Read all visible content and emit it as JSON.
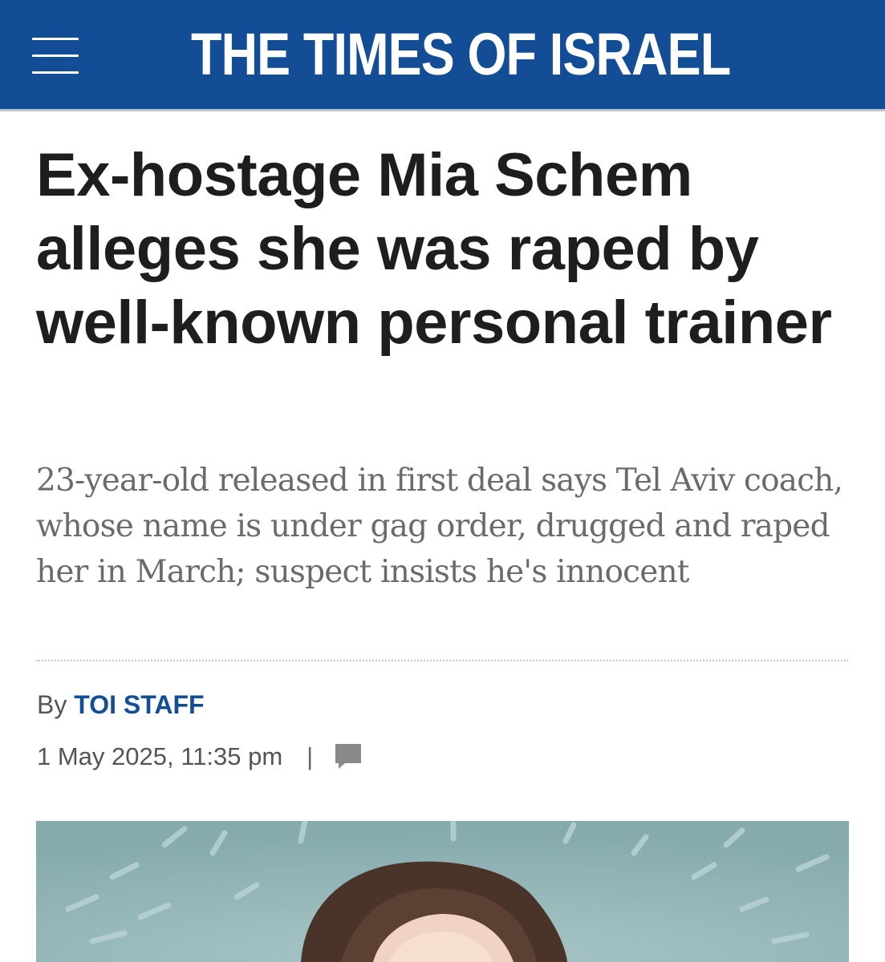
{
  "header": {
    "menu_icon": "hamburger-menu-icon",
    "site_name": "THE TIMES OF ISRAEL",
    "brand_color": "#124d96"
  },
  "article": {
    "headline": "Ex-hostage Mia Schem alleges she was raped by well-known personal trainer",
    "subheadline": "23-year-old released in first deal says Tel Aviv coach, whose name is under gag order, drugged and raped her in March; suspect insists he's innocent",
    "byline": {
      "prefix": "By",
      "author": "TOI STAFF"
    },
    "meta": {
      "date": "1 May 2025, 11:35 pm",
      "separator": "|",
      "comment_icon": "comment-icon"
    },
    "photo": {
      "description_icon": "article-photo"
    }
  }
}
